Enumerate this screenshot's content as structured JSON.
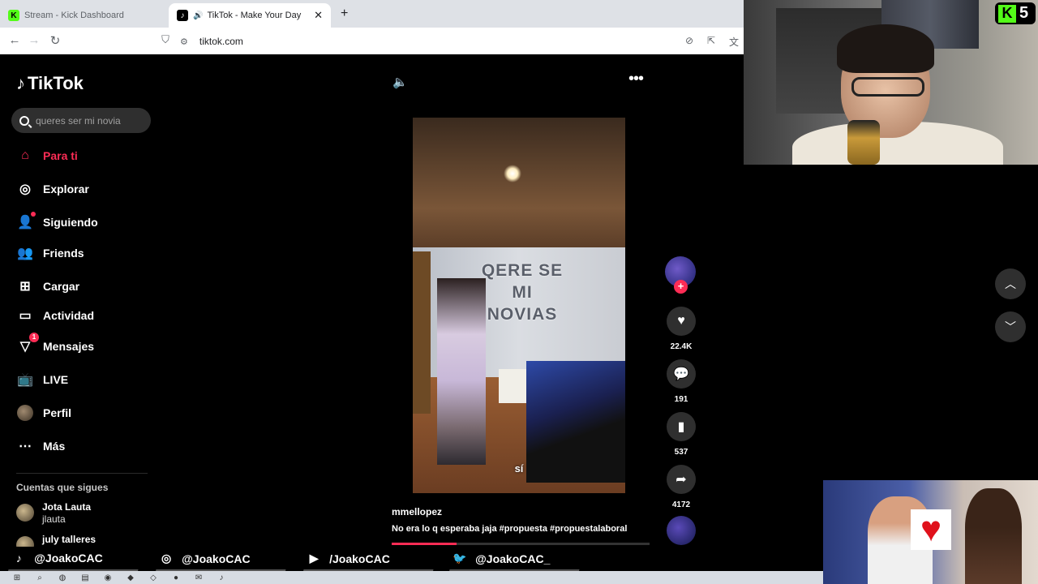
{
  "browser": {
    "tabs": [
      {
        "title": "Stream - Kick Dashboard",
        "favicon": "kick-icon"
      },
      {
        "title": "TikTok - Make Your Day",
        "favicon": "tiktok-icon",
        "active": true
      }
    ],
    "new_tab": "+",
    "url": "tiktok.com"
  },
  "tiktok": {
    "logo": "TikTok",
    "search_placeholder": "queres ser mi novia",
    "menu": [
      {
        "label": "Para ti",
        "icon": "home-icon"
      },
      {
        "label": "Explorar",
        "icon": "compass-icon"
      },
      {
        "label": "Siguiendo",
        "icon": "following-icon"
      },
      {
        "label": "Friends",
        "icon": "friends-icon"
      },
      {
        "label": "Cargar",
        "icon": "upload-icon"
      },
      {
        "label": "Actividad",
        "icon": "activity-icon"
      },
      {
        "label": "Mensajes",
        "icon": "messages-icon",
        "badge": "1"
      },
      {
        "label": "LIVE",
        "icon": "live-icon"
      },
      {
        "label": "Perfil",
        "icon": "profile-avatar"
      },
      {
        "label": "Más",
        "icon": "more-icon"
      }
    ],
    "following_title": "Cuentas que sigues",
    "following": [
      {
        "name": "Jota Lauta",
        "handle": "jlauta"
      },
      {
        "name": "july talleres",
        "handle": ""
      }
    ],
    "video": {
      "subtitle": "sí",
      "balloons_text": "QERE SE MI NOVIAS",
      "username": "mmellopez",
      "description": "No era lo q esperaba jaja #propuesta  #propuestalaboral",
      "progress": 0.25
    },
    "actions": {
      "likes": "22.4K",
      "comments": "191",
      "saves": "537",
      "shares": "4172"
    }
  },
  "overlay": {
    "kick_count": "5",
    "socials": [
      {
        "icon": "tiktok-icon",
        "handle": "@JoakoCAC"
      },
      {
        "icon": "instagram-icon",
        "handle": "@JoakoCAC"
      },
      {
        "icon": "youtube-icon",
        "handle": "/JoakoCAC"
      },
      {
        "icon": "twitter-icon",
        "handle": "@JoakoCAC_"
      }
    ]
  },
  "colors": {
    "accent": "#fe2c55",
    "kick_green": "#53fc18"
  }
}
